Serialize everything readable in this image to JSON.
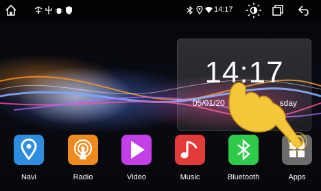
{
  "statusbar": {
    "time": "14:17"
  },
  "clock": {
    "time": "14:17",
    "date": "05/01/20",
    "day": "sday"
  },
  "apps": [
    {
      "label": "Navi",
      "icon": "location-pin-icon",
      "color": "#2f8de0"
    },
    {
      "label": "Radio",
      "icon": "radio-broadcast-icon",
      "color": "#f08a1c"
    },
    {
      "label": "Video",
      "icon": "play-icon",
      "color": "#c340e6"
    },
    {
      "label": "Music",
      "icon": "music-note-icon",
      "color": "#e53a3a"
    },
    {
      "label": "Bluetooth",
      "icon": "bluetooth-icon",
      "color": "#2ecb4a"
    },
    {
      "label": "Apps",
      "icon": "grid-icon",
      "color": "#6b6b6b"
    }
  ]
}
